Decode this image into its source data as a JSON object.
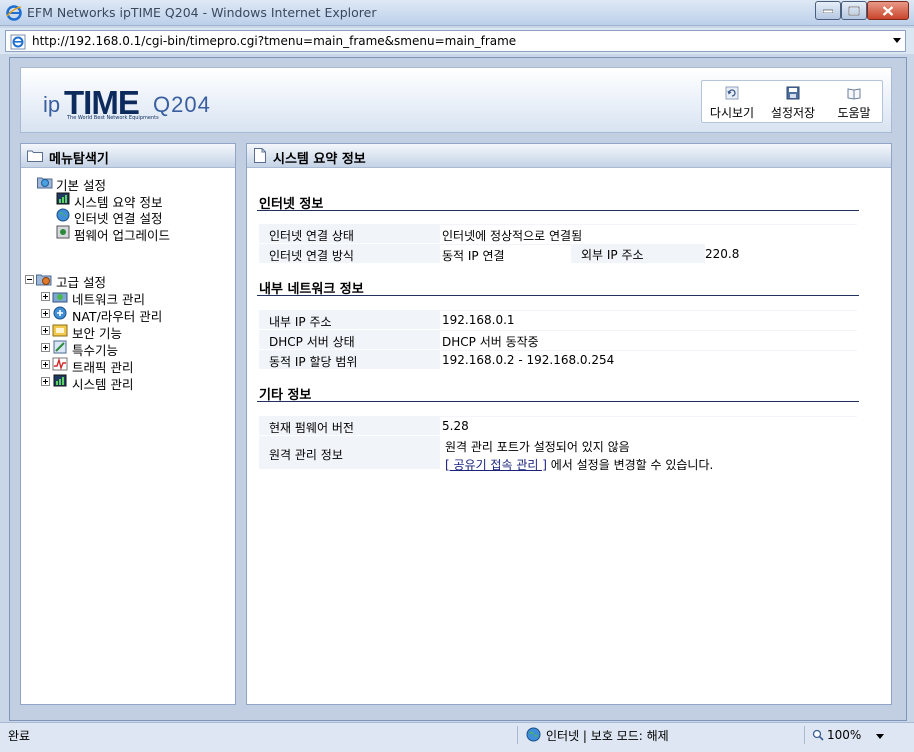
{
  "window": {
    "title": "EFM Networks ipTIME Q204 - Windows Internet Explorer"
  },
  "address_bar": {
    "url": "http://192.168.0.1/cgi-bin/timepro.cgi?tmenu=main_frame&smenu=main_frame"
  },
  "header": {
    "logo_ip": "ip",
    "logo_time": "TIME",
    "logo_tagline": "The World Best Network Equipments",
    "logo_model": "Q204",
    "tools": [
      {
        "label": "다시보기",
        "icon": "refresh-icon"
      },
      {
        "label": "설정저장",
        "icon": "save-icon"
      },
      {
        "label": "도움말",
        "icon": "help-book-icon"
      }
    ]
  },
  "menu": {
    "title": "메뉴탐색기",
    "basic": {
      "label": "기본 설정",
      "items": [
        "시스템 요약 정보",
        "인터넷 연결 설정",
        "펌웨어 업그레이드"
      ]
    },
    "advanced": {
      "label": "고급 설정",
      "items": [
        "네트워크 관리",
        "NAT/라우터 관리",
        "보안 기능",
        "특수기능",
        "트래픽 관리",
        "시스템 관리"
      ]
    }
  },
  "main": {
    "title": "시스템 요약 정보",
    "internet": {
      "heading": "인터넷 정보",
      "status_label": "인터넷 연결 상태",
      "status_value": "인터넷에 정상적으로 연결됨",
      "method_label": "인터넷 연결 방식",
      "method_value": "동적 IP 연결",
      "external_ip_label": "외부 IP 주소",
      "external_ip_value": "220.8"
    },
    "lan": {
      "heading": "내부 네트워크 정보",
      "ip_label": "내부 IP 주소",
      "ip_value": "192.168.0.1",
      "dhcp_label": "DHCP 서버 상태",
      "dhcp_value": "DHCP 서버 동작중",
      "range_label": "동적 IP 할당 범위",
      "range_value": "192.168.0.2 -  192.168.0.254"
    },
    "etc": {
      "heading": "기타 정보",
      "fw_label": "현재 펌웨어 버전",
      "fw_value": "5.28",
      "remote_label": "원격 관리 정보",
      "remote_line1": "원격 관리 포트가 설정되어 있지 않음",
      "remote_link": "[ 공유기 접속 관리 ]",
      "remote_line2": "에서 설정을 변경할 수 있습니다."
    }
  },
  "statusbar": {
    "left": "완료",
    "zone": "인터넷 | 보호 모드: 해제",
    "zoom": "100%"
  }
}
